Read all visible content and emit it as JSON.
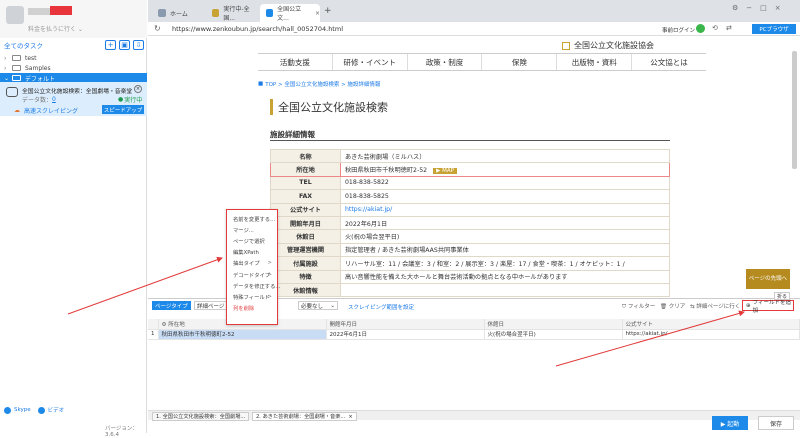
{
  "user": {
    "sub": "料金を払うに行く ⌄"
  },
  "sidebar": {
    "all_tasks": "全てのタスク",
    "items": [
      {
        "label": "test"
      },
      {
        "label": "Samples"
      },
      {
        "label": "デフォルト"
      }
    ],
    "task": {
      "title": "全国公立文化施設検索：全国劇場・音楽堂等",
      "data_count_label": "データ数：",
      "data_count": "0",
      "status": "実行中",
      "cloud_label": "高速スクレイピング",
      "speedup": "スピードアップ"
    },
    "help": "Skype",
    "community": "ビデオ",
    "version": "バージョン：3.6.4"
  },
  "browser": {
    "tabs": [
      {
        "label": "ホーム"
      },
      {
        "label": "実行中-全国..."
      },
      {
        "label": "全国公立文..."
      }
    ],
    "url": "https://www.zenkoubun.jp/search/hall_0052704.html",
    "login": "事前ログイン",
    "pc_browser": "PCブラウザ"
  },
  "site": {
    "logo": "全国公立文化施設協会",
    "nav": [
      "活動支援",
      "研修・イベント",
      "政策・制度",
      "保険",
      "出版物・資料",
      "公文協とは"
    ],
    "breadcrumb": "TOP > 全国公立文化施設検索 > 施設詳細情報",
    "title": "全国公立文化施設検索",
    "section": "施設詳細情報",
    "rows": [
      {
        "k": "名称",
        "v": "あきた芸術劇場（ミルハス）"
      },
      {
        "k": "所在地",
        "v": "秋田県秋田市千秋明徳町2-52",
        "map": "MAP"
      },
      {
        "k": "TEL",
        "v": "018-838-5822"
      },
      {
        "k": "FAX",
        "v": "018-838-5825"
      },
      {
        "k": "公式サイト",
        "v": "https://akiat.jp/"
      },
      {
        "k": "開館年月日",
        "v": "2022年6月1日"
      },
      {
        "k": "休館日",
        "v": "火(祝の場合翌平日)"
      },
      {
        "k": "管理運営機関",
        "v": "指定管理者 / あきた芸術劇場AAS共同事業体"
      },
      {
        "k": "付属施設",
        "v": "リハーサル室：11 / 会議室：3 / 和室：2 / 展示室：3 / 楽屋：17 / 食堂・喫茶：1 / オケピット：1 /"
      },
      {
        "k": "特徴",
        "v": "高い音響性能を備えた大ホールと舞台芸術活動の拠点となる中ホールがあります"
      },
      {
        "k": "休館情報",
        "v": ""
      }
    ],
    "back_top": "ページの先頭へ"
  },
  "context_menu": [
    {
      "label": "名前を変更する...",
      "sub": ""
    },
    {
      "label": "マージ...",
      "sub": ""
    },
    {
      "label": "ページで選択",
      "sub": ""
    },
    {
      "label": "編集XPath",
      "sub": ""
    },
    {
      "label": "抽出タイプ",
      "sub": ">"
    },
    {
      "label": "デコードタイプ",
      "sub": ">"
    },
    {
      "label": "データを修正する...",
      "sub": ""
    },
    {
      "label": "特殊フィールド",
      "sub": ">"
    },
    {
      "label": "列を削除",
      "sub": ""
    }
  ],
  "bottom": {
    "page_type": "ページタイプ",
    "mode": "詳細ページ",
    "select": "必要なし",
    "hint": "スクレイピング範囲を設定",
    "filter": "フィルター",
    "clear": "クリア",
    "detail": "詳細ページに行く",
    "add_field": "フィールドを追加",
    "collapse": "折る",
    "headers": [
      "所在地",
      "開館年月日",
      "休館日",
      "公式サイト"
    ],
    "row": {
      "index": "1",
      "c1": "秋田県秋田市千秋明徳町2-52",
      "c2": "2022年6月1日",
      "c3": "火(祝の場合翌平日)",
      "c4": "https://akiat.jp/"
    }
  },
  "status_tabs": [
    {
      "label": "1. 全国公立文化施設検索：全国劇場..."
    },
    {
      "label": "2. あきた芸術劇場：全国劇場・音楽..."
    }
  ],
  "footer": {
    "start": "▶ 起動",
    "save": "保存"
  }
}
